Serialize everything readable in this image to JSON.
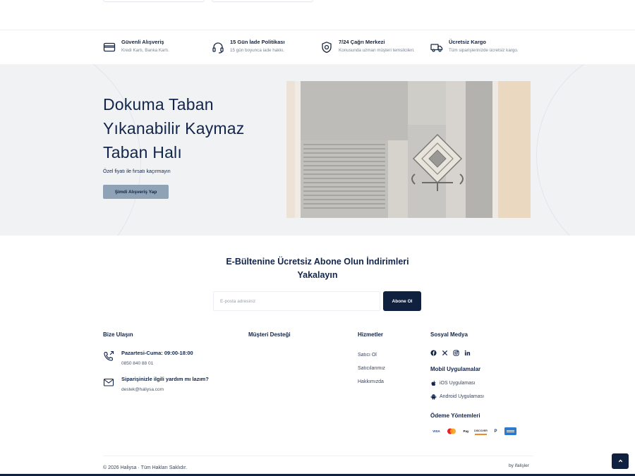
{
  "features": [
    {
      "icon": "credit-card-icon",
      "title": "Güvenli Alışveriş",
      "subtitle": "Kredi Kartı, Banka Kartı."
    },
    {
      "icon": "headset-icon",
      "title": "15 Gün İade Politikası",
      "subtitle": "15 gün boyunca iade hakkı."
    },
    {
      "icon": "shield-icon",
      "title": "7/24 Çağrı Merkezi",
      "subtitle": "Konusunda uzman müşteri temsilcileri."
    },
    {
      "icon": "truck-icon",
      "title": "Ücretsiz Kargo",
      "subtitle": "Tüm siparişlerinizde ücretsiz kargo."
    }
  ],
  "hero": {
    "title": "Dokuma Taban Yıkanabilir Kaymaz Taban Halı",
    "subtitle": "Özel fiyatı ile fırsatı kaçırmayın",
    "button": "Şimdi Alışveriş Yap"
  },
  "newsletter": {
    "title": "E-Bültenine Ücretsiz Abone Olun İndirimleri Yakalayın",
    "placeholder": "E-posta adresiniz",
    "button": "Abone Ol"
  },
  "footer": {
    "contact": {
      "heading": "Bize Ulaşın",
      "phone_label": "Pazartesi-Cuma: 09:00-18:00",
      "phone": "0850 840 88 01",
      "email_label": "Siparişinizle ilgili yardım mı lazım?",
      "email": "destek@haliysa.com"
    },
    "support": {
      "heading": "Müşteri Desteği"
    },
    "services": {
      "heading": "Hizmetler",
      "links": [
        "Satıcı Ol",
        "Satıcılarımız",
        "Hakkımızda"
      ]
    },
    "social": {
      "heading": "Sosyal Medya",
      "icons": [
        "facebook-icon",
        "x-icon",
        "instagram-icon",
        "linkedin-icon"
      ]
    },
    "apps": {
      "heading": "Mobil Uygulamalar",
      "ios": "iOS Uygulaması",
      "android": "Android Uygulaması"
    },
    "payments": {
      "heading": "Ödeme Yöntemleri",
      "methods": [
        "visa",
        "mastercard",
        "apple-pay",
        "discover",
        "paypal",
        "american-express"
      ],
      "visa_text": "VISA",
      "applepay_text": "Pay",
      "discover_text": "DISCOVER",
      "paypal_text": "P"
    },
    "copyright": "© 2026 Haliysa · Tüm Hakları Saklıdır.",
    "by": "by ifalişler"
  },
  "colors": {
    "navy": "#10203f",
    "hero_bg": "#f1f2f4",
    "hero_button": "#8fa2b6"
  }
}
